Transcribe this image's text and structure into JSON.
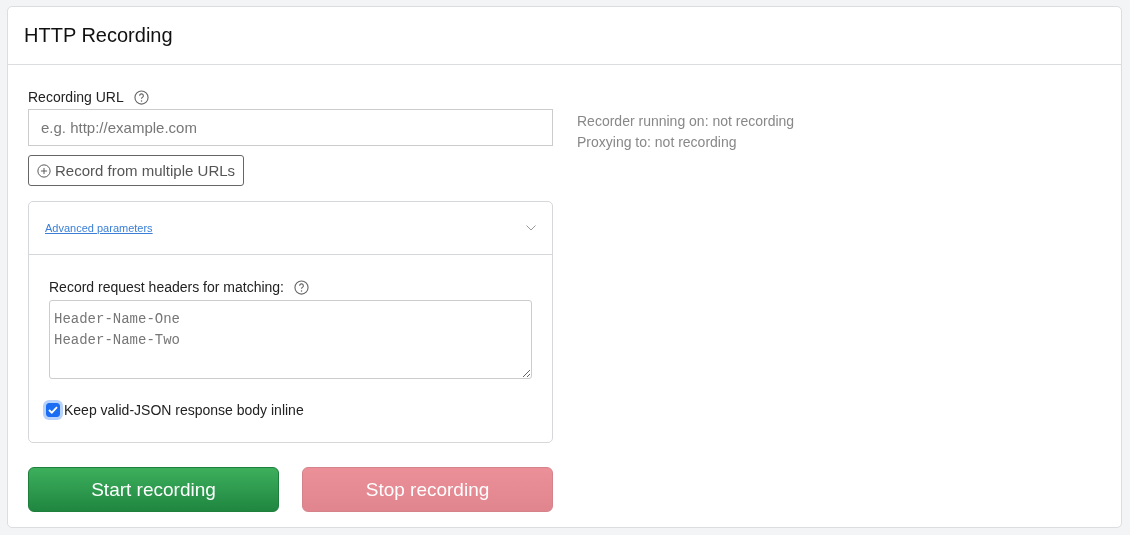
{
  "panel": {
    "title": "HTTP Recording"
  },
  "url_field": {
    "label": "Recording URL",
    "placeholder": "e.g. http://example.com"
  },
  "multi_button": {
    "label": "Record from multiple URLs"
  },
  "advanced": {
    "link": "Advanced parameters",
    "expanded": true,
    "headers_label": "Record request headers for matching:",
    "headers_placeholder": "Header-Name-One\nHeader-Name-Two",
    "keep_json": {
      "label": "Keep valid-JSON response body inline",
      "checked": true
    }
  },
  "status": [
    "Recorder running on: not recording",
    "Proxying to: not recording"
  ],
  "buttons": [
    {
      "label": "Start recording",
      "kind": "start",
      "disabled": false
    },
    {
      "label": "Stop recording",
      "kind": "stop",
      "disabled": true
    }
  ]
}
